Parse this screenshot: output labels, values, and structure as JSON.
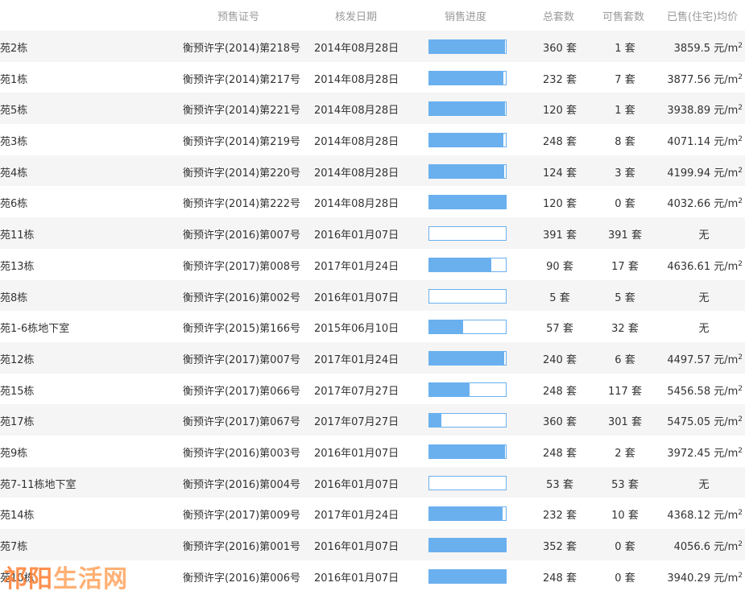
{
  "header": {
    "license": "预售证号",
    "date": "核发日期",
    "progress": "销售进度",
    "total": "总套数",
    "available": "可售套数",
    "avg_price": "已售(住宅)均价"
  },
  "units": {
    "tao": "套",
    "price_unit": "元/m",
    "price_sup": "2",
    "none": "无"
  },
  "colors": {
    "progress_fill": "#6ab0ef",
    "stripe": "#f5f5f5",
    "watermark": "#ff7a2a"
  },
  "rows": [
    {
      "name": "苑2栋",
      "license": "衡预许字(2014)第218号",
      "date": "2014年08月28日",
      "progress": 0.99,
      "total": "360 套",
      "available": "1 套",
      "price": "3859.5 元/m",
      "has_price": true
    },
    {
      "name": "苑1栋",
      "license": "衡预许字(2014)第217号",
      "date": "2014年08月28日",
      "progress": 0.97,
      "total": "232 套",
      "available": "7 套",
      "price": "3877.56 元/m",
      "has_price": true
    },
    {
      "name": "苑5栋",
      "license": "衡预许字(2014)第221号",
      "date": "2014年08月28日",
      "progress": 0.99,
      "total": "120 套",
      "available": "1 套",
      "price": "3938.89 元/m",
      "has_price": true
    },
    {
      "name": "苑3栋",
      "license": "衡预许字(2014)第219号",
      "date": "2014年08月28日",
      "progress": 0.97,
      "total": "248 套",
      "available": "8 套",
      "price": "4071.14 元/m",
      "has_price": true
    },
    {
      "name": "苑4栋",
      "license": "衡预许字(2014)第220号",
      "date": "2014年08月28日",
      "progress": 0.98,
      "total": "124 套",
      "available": "3 套",
      "price": "4199.94 元/m",
      "has_price": true
    },
    {
      "name": "苑6栋",
      "license": "衡预许字(2014)第222号",
      "date": "2014年08月28日",
      "progress": 1.0,
      "total": "120 套",
      "available": "0 套",
      "price": "4032.66 元/m",
      "has_price": true
    },
    {
      "name": "苑11栋",
      "license": "衡预许字(2016)第007号",
      "date": "2016年01月07日",
      "progress": 0.0,
      "total": "391 套",
      "available": "391 套",
      "price": "无",
      "has_price": false
    },
    {
      "name": "苑13栋",
      "license": "衡预许字(2017)第008号",
      "date": "2017年01月24日",
      "progress": 0.81,
      "total": "90 套",
      "available": "17 套",
      "price": "4636.61 元/m",
      "has_price": true
    },
    {
      "name": "苑8栋",
      "license": "衡预许字(2016)第002号",
      "date": "2016年01月07日",
      "progress": 0.0,
      "total": "5 套",
      "available": "5 套",
      "price": "无",
      "has_price": false
    },
    {
      "name": "苑1-6栋地下室",
      "license": "衡预许字(2015)第166号",
      "date": "2015年06月10日",
      "progress": 0.44,
      "total": "57 套",
      "available": "32 套",
      "price": "无",
      "has_price": false
    },
    {
      "name": "苑12栋",
      "license": "衡预许字(2017)第007号",
      "date": "2017年01月24日",
      "progress": 0.98,
      "total": "240 套",
      "available": "6 套",
      "price": "4497.57 元/m",
      "has_price": true
    },
    {
      "name": "苑15栋",
      "license": "衡预许字(2017)第066号",
      "date": "2017年07月27日",
      "progress": 0.53,
      "total": "248 套",
      "available": "117 套",
      "price": "5456.58 元/m",
      "has_price": true
    },
    {
      "name": "苑17栋",
      "license": "衡预许字(2017)第067号",
      "date": "2017年07月27日",
      "progress": 0.16,
      "total": "360 套",
      "available": "301 套",
      "price": "5475.05 元/m",
      "has_price": true
    },
    {
      "name": "苑9栋",
      "license": "衡预许字(2016)第003号",
      "date": "2016年01月07日",
      "progress": 0.99,
      "total": "248 套",
      "available": "2 套",
      "price": "3972.45 元/m",
      "has_price": true
    },
    {
      "name": "苑7-11栋地下室",
      "license": "衡预许字(2016)第004号",
      "date": "2016年01月07日",
      "progress": 0.0,
      "total": "53 套",
      "available": "53 套",
      "price": "无",
      "has_price": false
    },
    {
      "name": "苑14栋",
      "license": "衡预许字(2017)第009号",
      "date": "2017年01月24日",
      "progress": 0.96,
      "total": "232 套",
      "available": "10 套",
      "price": "4368.12 元/m",
      "has_price": true
    },
    {
      "name": "苑7栋",
      "license": "衡预许字(2016)第001号",
      "date": "2016年01月07日",
      "progress": 1.0,
      "total": "352 套",
      "available": "0 套",
      "price": "4056.6 元/m",
      "has_price": true
    },
    {
      "name": "苑10栋",
      "license": "衡预许字(2016)第006号",
      "date": "2016年01月07日",
      "progress": 1.0,
      "total": "248 套",
      "available": "0 套",
      "price": "3940.29 元/m",
      "has_price": true
    }
  ],
  "watermark": {
    "text_a": "祁阳",
    "text_b": "生活网"
  }
}
